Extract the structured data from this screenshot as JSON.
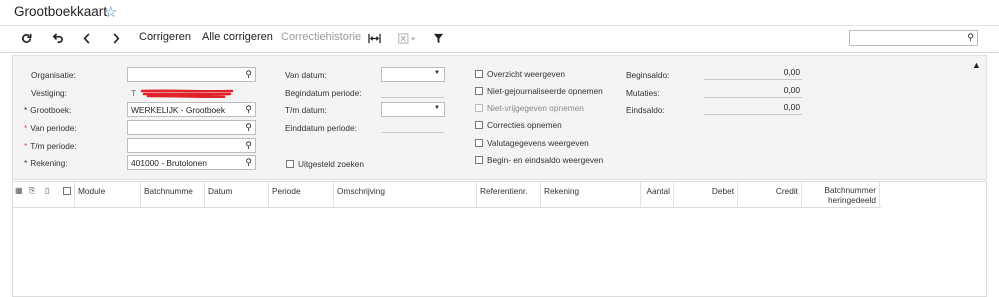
{
  "title": "Grootboekkaart",
  "toolbar": {
    "correct": "Corrigeren",
    "correct_all": "Alle corrigeren",
    "history": "Correctiehistorie"
  },
  "left_fields": [
    {
      "label": "Organisatie:",
      "marker": "",
      "value": ""
    },
    {
      "label": "Vestiging:",
      "marker": "",
      "value": "T"
    },
    {
      "label": "Grootboek:",
      "marker": "*",
      "value": "WERKELIJK - Grootboek"
    },
    {
      "label": "Van periode:",
      "marker": "*",
      "value": ""
    },
    {
      "label": "T/m periode:",
      "marker": "*",
      "value": ""
    },
    {
      "label": "Rekening:",
      "marker": "*",
      "value": "401000 - Brutolonen"
    }
  ],
  "mid": {
    "from_date": "Van datum:",
    "period_start": "Begindatum periode:",
    "to_date": "T/m datum:",
    "period_end": "Einddatum periode:",
    "postponed": "Uitgesteld zoeken"
  },
  "checks": [
    {
      "label": "Overzicht weergeven",
      "disabled": false
    },
    {
      "label": "Niet-gejournaliseerde opnemen",
      "disabled": false
    },
    {
      "label": "Niet-vrijgegeven opnemen",
      "disabled": true
    },
    {
      "label": "Correcties opnemen",
      "disabled": false
    },
    {
      "label": "Valutagegevens weergeven",
      "disabled": false
    },
    {
      "label": "Begin- en eindsaldo weergeven",
      "disabled": false
    }
  ],
  "balances": {
    "begin_label": "Beginsaldo:",
    "begin_value": "0,00",
    "mut_label": "Mutaties:",
    "mut_value": "0,00",
    "end_label": "Eindsaldo:",
    "end_value": "0,00"
  },
  "columns": [
    "Module",
    "Batchnumme",
    "Datum",
    "Periode",
    "Omschrijving",
    "Referentienr.",
    "Rekening",
    "Aantal",
    "Debet",
    "Credit",
    "Batchnummer heringedeeld"
  ],
  "icons": {
    "refresh": "refresh-icon",
    "undo": "undo-icon",
    "prev": "chevron-left-icon",
    "next": "chevron-right-icon",
    "fit": "fit-columns-icon",
    "export": "excel-export-icon",
    "filter": "filter-icon",
    "star": "star-icon"
  }
}
